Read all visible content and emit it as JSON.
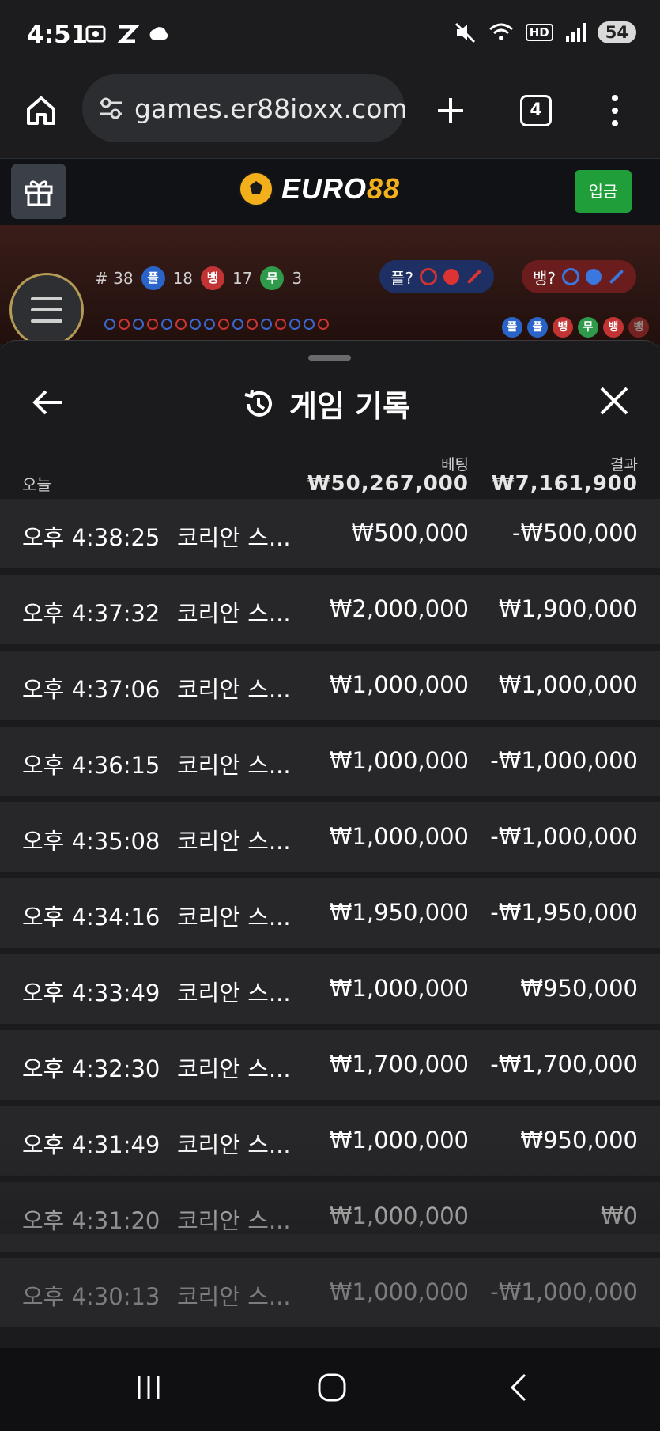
{
  "status_bar": {
    "time": "4:51",
    "battery": "54",
    "hd_label": "HD"
  },
  "browser": {
    "url": "games.er88ioxx.com",
    "tab_count": "4"
  },
  "site": {
    "brand_part1": "EURO",
    "brand_part2": "88",
    "deposit_label": "입금"
  },
  "game_strip": {
    "round": "# 38",
    "player_label": "플",
    "player_count": "18",
    "banker_label": "뱅",
    "banker_count": "17",
    "tie_label": "무",
    "tie_count": "3",
    "player_predict": "플?",
    "banker_predict": "뱅?",
    "recent": [
      "플",
      "플",
      "뱅",
      "무",
      "뱅",
      "뱅"
    ]
  },
  "history": {
    "title": "게임 기록",
    "today_label": "오늘",
    "bet_header": "베팅",
    "result_header": "결과",
    "bet_total": "₩50,267,000",
    "result_total": "₩7,161,900",
    "rows": [
      {
        "time": "오후 4:38:25",
        "game": "코리안 스...",
        "bet": "₩500,000",
        "result": "-₩500,000"
      },
      {
        "time": "오후 4:37:32",
        "game": "코리안 스...",
        "bet": "₩2,000,000",
        "result": "₩1,900,000"
      },
      {
        "time": "오후 4:37:06",
        "game": "코리안 스...",
        "bet": "₩1,000,000",
        "result": "₩1,000,000"
      },
      {
        "time": "오후 4:36:15",
        "game": "코리안 스...",
        "bet": "₩1,000,000",
        "result": "-₩1,000,000"
      },
      {
        "time": "오후 4:35:08",
        "game": "코리안 스...",
        "bet": "₩1,000,000",
        "result": "-₩1,000,000"
      },
      {
        "time": "오후 4:34:16",
        "game": "코리안 스...",
        "bet": "₩1,950,000",
        "result": "-₩1,950,000"
      },
      {
        "time": "오후 4:33:49",
        "game": "코리안 스...",
        "bet": "₩1,000,000",
        "result": "₩950,000"
      },
      {
        "time": "오후 4:32:30",
        "game": "코리안 스...",
        "bet": "₩1,700,000",
        "result": "-₩1,700,000"
      },
      {
        "time": "오후 4:31:49",
        "game": "코리안 스...",
        "bet": "₩1,000,000",
        "result": "₩950,000"
      },
      {
        "time": "오후 4:31:20",
        "game": "코리안 스...",
        "bet": "₩1,000,000",
        "result": "₩0"
      },
      {
        "time": "오후 4:30:13",
        "game": "코리안 스...",
        "bet": "₩1,000,000",
        "result": "-₩1,000,000"
      }
    ]
  },
  "colors": {
    "accent_gold": "#f4b01a",
    "deposit_green": "#1f9e3a",
    "player_blue": "#2b64c8",
    "banker_red": "#c23434",
    "tie_green": "#2e9a4a"
  }
}
